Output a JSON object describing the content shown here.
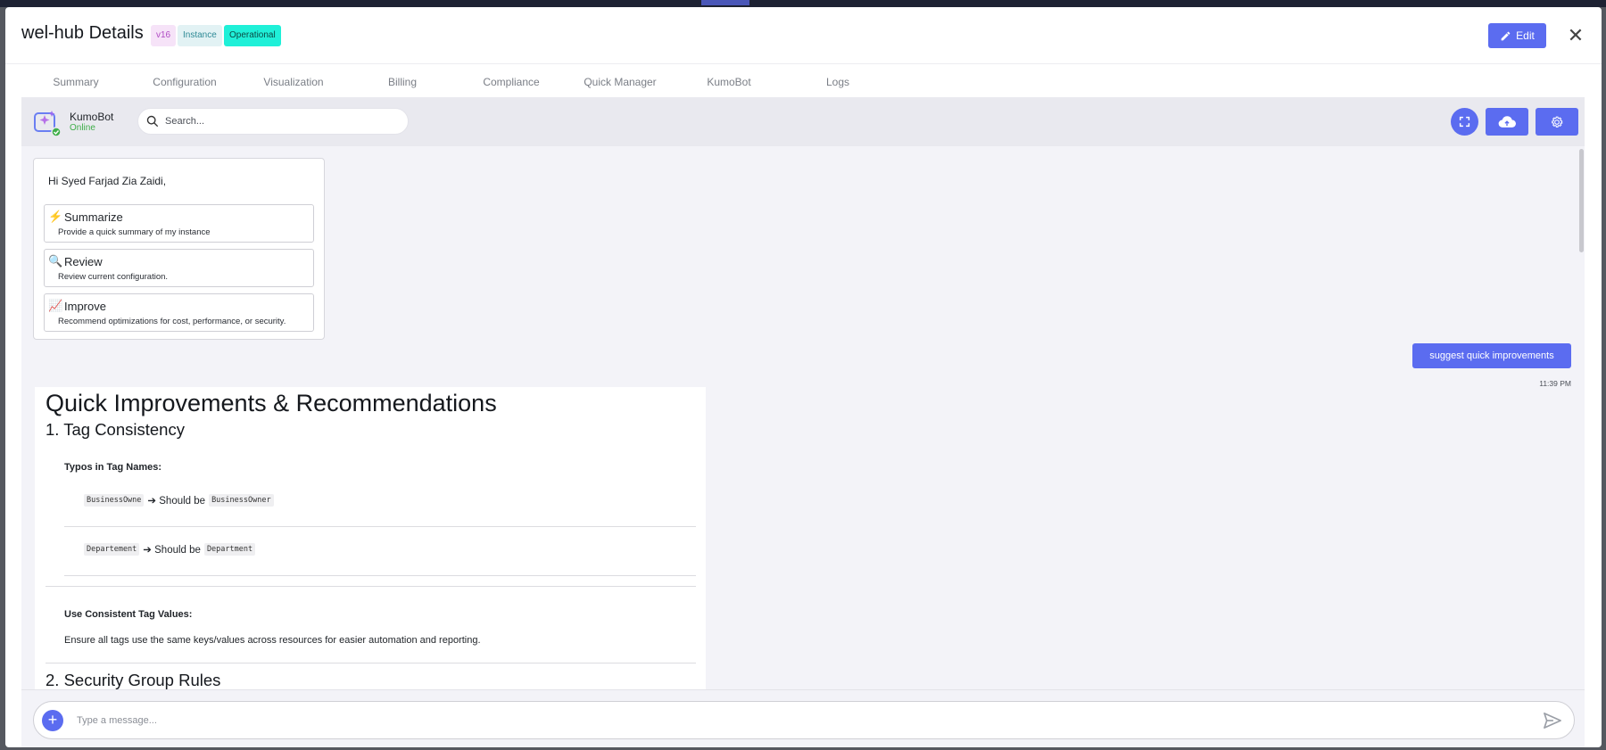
{
  "header": {
    "title": "wel-hub Details",
    "badges": {
      "version": "v16",
      "type": "Instance",
      "status": "Operational"
    },
    "edit_label": "Edit"
  },
  "tabs": [
    {
      "label": "Summary"
    },
    {
      "label": "Configuration"
    },
    {
      "label": "Visualization"
    },
    {
      "label": "Billing"
    },
    {
      "label": "Compliance"
    },
    {
      "label": "Quick Manager"
    },
    {
      "label": "KumoBot",
      "active": true
    },
    {
      "label": "Logs"
    }
  ],
  "chat": {
    "bot_name": "KumoBot",
    "bot_status": "Online",
    "search": {
      "placeholder": "Search..."
    },
    "toolbar_icons": [
      "expand-icon",
      "cloud-upload-icon",
      "gear-icon"
    ],
    "welcome": {
      "greeting": "Hi Syed Farjad Zia Zaidi,",
      "cards": [
        {
          "icon": "⚡",
          "title": "Summarize",
          "desc": "Provide a quick summary of my instance"
        },
        {
          "icon": "🔍",
          "title": "Review",
          "desc": "Review current configuration."
        },
        {
          "icon": "📈",
          "title": "Improve",
          "desc": "Recommend optimizations for cost, performance, or security."
        }
      ]
    },
    "user_message": {
      "text": "suggest quick improvements",
      "time": "11:39 PM"
    },
    "reply": {
      "heading": "Quick Improvements & Recommendations",
      "section1": "1. Tag Consistency",
      "typos_label": "Typos in Tag Names:",
      "typo1": {
        "wrong": "BusinessOwne",
        "arrow": "➔ Should be",
        "right": "BusinessOwner"
      },
      "typo2": {
        "wrong": "Departement",
        "arrow": "➔ Should be",
        "right": "Department"
      },
      "consistent_label": "Use Consistent Tag Values:",
      "consistent_text": "Ensure all tags use the same keys/values across resources for easier automation and reporting.",
      "section2": "2. Security Group Rules"
    },
    "composer": {
      "placeholder": "Type a message..."
    }
  },
  "colors": {
    "accent": "#5b6cf0",
    "status": "#1ff0d8",
    "online": "#3fae49"
  }
}
